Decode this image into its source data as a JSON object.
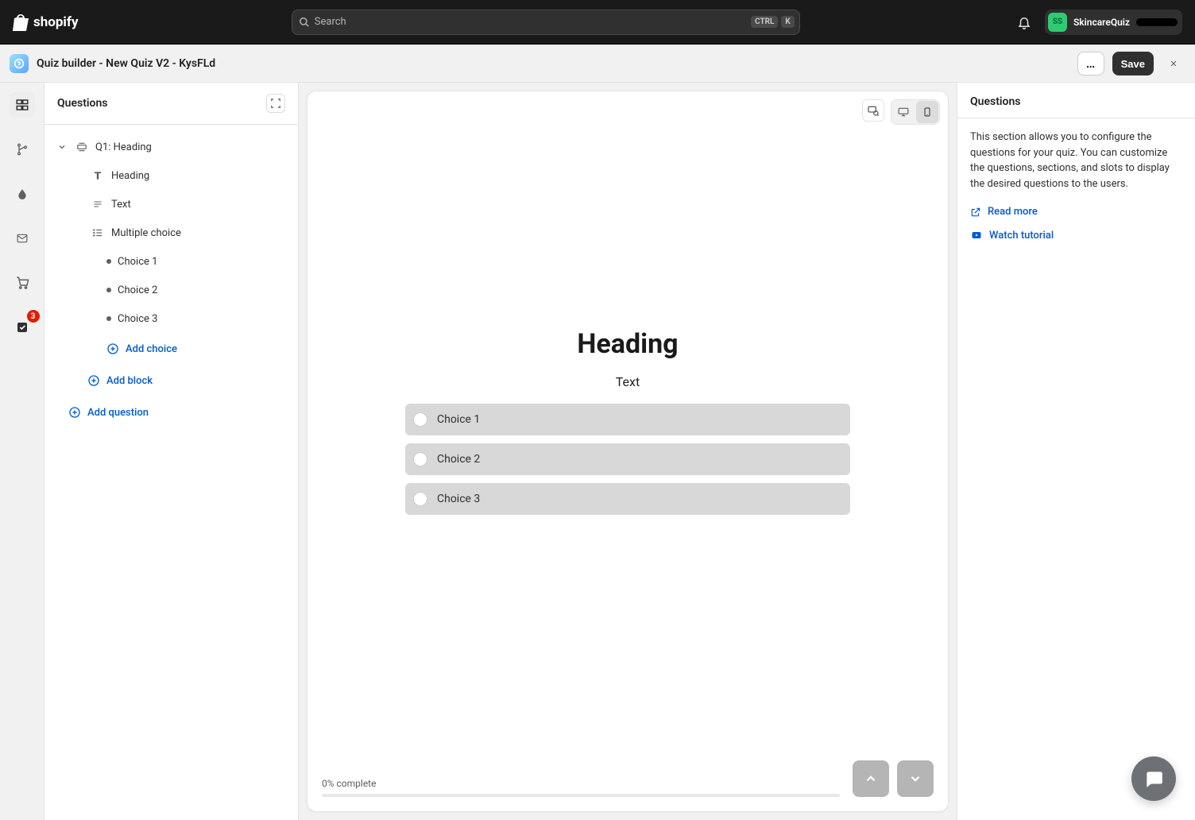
{
  "topbar": {
    "brand": "shopify",
    "search_placeholder": "Search",
    "search_keys": [
      "CTRL",
      "K"
    ],
    "account_initials": "SS",
    "account_name": "SkincareQuiz"
  },
  "subheader": {
    "title": "Quiz builder - New Quiz V2 - KysFLd",
    "more_label": "...",
    "save_label": "Save"
  },
  "rail": {
    "badge_count": "3"
  },
  "left_panel": {
    "title": "Questions",
    "question_label": "Q1: Heading",
    "blocks": {
      "heading": "Heading",
      "text": "Text",
      "multiple_choice": "Multiple choice"
    },
    "choices": [
      "Choice 1",
      "Choice 2",
      "Choice 3"
    ],
    "add_choice": "Add choice",
    "add_block": "Add block",
    "add_question": "Add question"
  },
  "preview": {
    "heading": "Heading",
    "text": "Text",
    "choices": [
      "Choice 1",
      "Choice 2",
      "Choice 3"
    ],
    "progress_label": "0% complete"
  },
  "right_panel": {
    "title": "Questions",
    "description": "This section allows you to configure the questions for your quiz. You can customize the questions, sections, and slots to display the desired questions to the users.",
    "read_more": "Read more",
    "watch_tutorial": "Watch tutorial"
  }
}
